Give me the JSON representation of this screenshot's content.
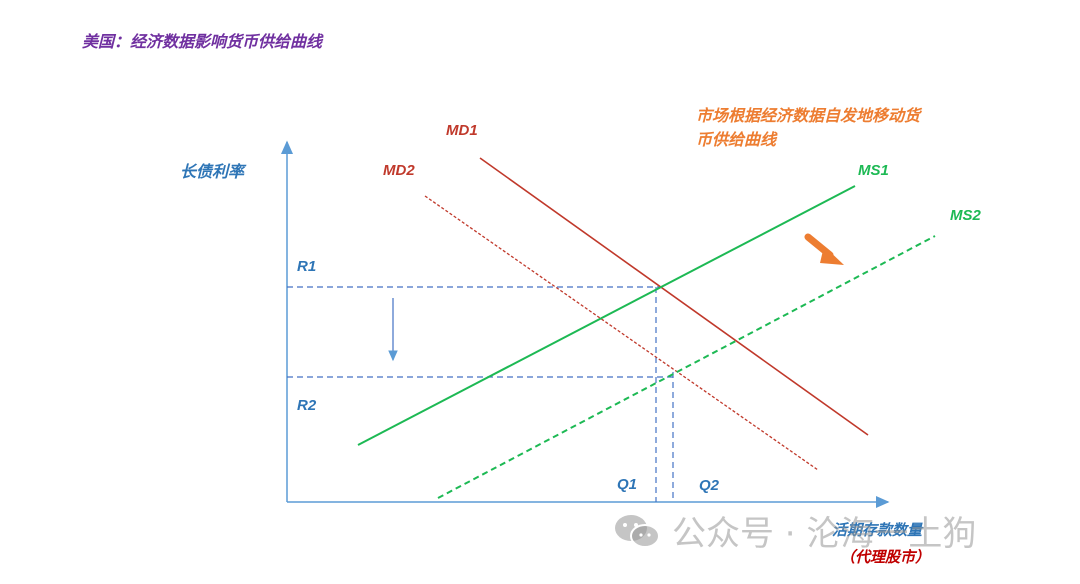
{
  "title": "美国：经济数据影响货币供给曲线",
  "axes": {
    "y_label": "长债利率",
    "x_label": "活期存款数量",
    "x_sublabel": "（代理股市）"
  },
  "annotation": {
    "line1": "市场根据经济数据自发地移动货",
    "line2": "币供给曲线"
  },
  "curves": {
    "md1": "MD1",
    "md2": "MD2",
    "ms1": "MS1",
    "ms2": "MS2"
  },
  "levels": {
    "r1": "R1",
    "r2": "R2",
    "q1": "Q1",
    "q2": "Q2"
  },
  "watermark": {
    "text": "公众号 · 沦海一土狗",
    "icon": "wechat-icon"
  },
  "colors": {
    "title": "#7030A0",
    "axis": "#5B9BD5",
    "label_blue": "#2E75B6",
    "demand": "#C0392B",
    "supply": "#1DB954",
    "arrow": "#ED7D31"
  }
}
